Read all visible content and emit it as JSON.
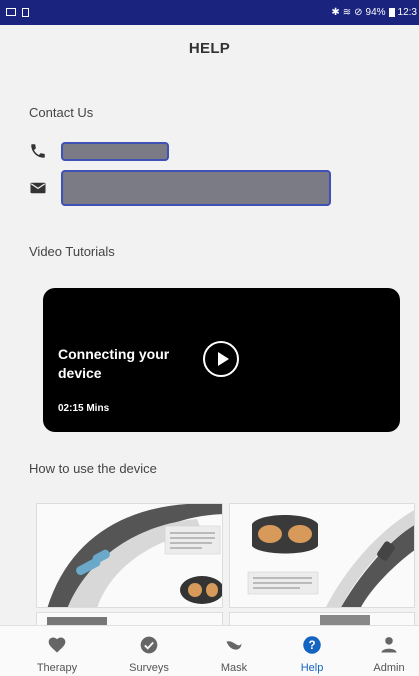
{
  "status_bar": {
    "battery": "94%",
    "time": "12:3"
  },
  "header": {
    "title": "HELP"
  },
  "contact": {
    "section_title": "Contact Us",
    "phone_icon": "phone-icon",
    "email_icon": "mail-icon"
  },
  "video": {
    "section_title": "Video Tutorials",
    "card": {
      "title": "Connecting your device",
      "duration": "02:15 Mins"
    }
  },
  "howto": {
    "section_title": "How to use the device"
  },
  "nav": {
    "items": [
      {
        "label": "Therapy",
        "icon": "heart-icon"
      },
      {
        "label": "Surveys",
        "icon": "check-circle-icon"
      },
      {
        "label": "Mask",
        "icon": "mask-icon"
      },
      {
        "label": "Help",
        "icon": "help-icon"
      },
      {
        "label": "Admin",
        "icon": "person-icon"
      }
    ],
    "active": "Help"
  },
  "colors": {
    "status_bar": "#1a237e",
    "accent": "#1565c0",
    "nav_icon": "#666666"
  }
}
